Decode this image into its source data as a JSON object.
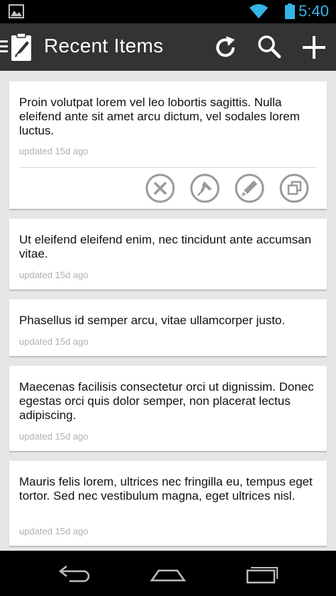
{
  "status_bar": {
    "time": "5:40",
    "icons": [
      "gallery-notification-icon",
      "wifi-icon",
      "battery-icon"
    ],
    "accent": "#33b5e5"
  },
  "action_bar": {
    "title": "Recent Items",
    "actions": [
      "refresh-icon",
      "search-icon",
      "add-icon"
    ],
    "background": "#333333"
  },
  "items": [
    {
      "text": "Proin volutpat lorem vel leo lobortis sagittis. Nulla eleifend ante sit amet arcu dictum, vel sodales lorem luctus.",
      "meta": "updated 15d ago",
      "expanded": true,
      "actions": [
        "delete-icon",
        "pin-icon",
        "edit-icon",
        "duplicate-icon"
      ]
    },
    {
      "text": "Ut eleifend eleifend enim, nec tincidunt ante accumsan vitae.",
      "meta": "updated 15d ago"
    },
    {
      "text": "Phasellus id semper arcu, vitae ullamcorper justo.",
      "meta": "updated 15d ago"
    },
    {
      "text": "Maecenas facilisis consectetur orci ut dignissim. Donec egestas orci quis dolor semper, non placerat lectus adipiscing.",
      "meta": "updated 15d ago"
    },
    {
      "text": "Mauris felis lorem, ultrices nec fringilla eu, tempus eget tortor. Sed nec vestibulum magna, eget ultrices nisl.",
      "meta": "updated 15d ago"
    }
  ],
  "nav_bar": {
    "buttons": [
      "back-icon",
      "home-icon",
      "recent-apps-icon"
    ]
  }
}
